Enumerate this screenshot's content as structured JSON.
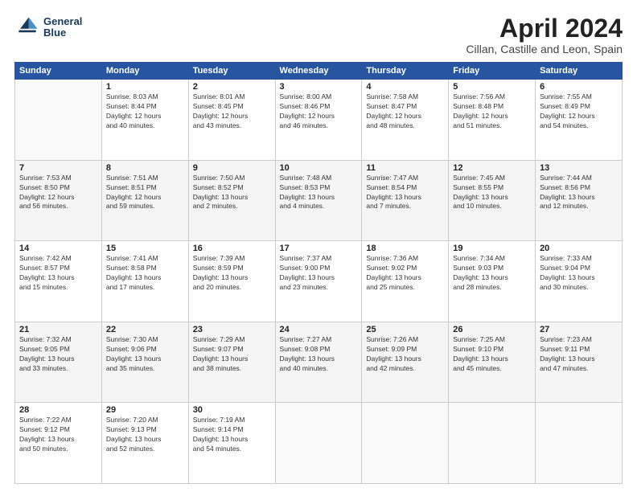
{
  "header": {
    "logo_line1": "General",
    "logo_line2": "Blue",
    "title": "April 2024",
    "subtitle": "Cillan, Castille and Leon, Spain"
  },
  "days_of_week": [
    "Sunday",
    "Monday",
    "Tuesday",
    "Wednesday",
    "Thursday",
    "Friday",
    "Saturday"
  ],
  "weeks": [
    [
      {
        "day": "",
        "info": ""
      },
      {
        "day": "1",
        "info": "Sunrise: 8:03 AM\nSunset: 8:44 PM\nDaylight: 12 hours\nand 40 minutes."
      },
      {
        "day": "2",
        "info": "Sunrise: 8:01 AM\nSunset: 8:45 PM\nDaylight: 12 hours\nand 43 minutes."
      },
      {
        "day": "3",
        "info": "Sunrise: 8:00 AM\nSunset: 8:46 PM\nDaylight: 12 hours\nand 46 minutes."
      },
      {
        "day": "4",
        "info": "Sunrise: 7:58 AM\nSunset: 8:47 PM\nDaylight: 12 hours\nand 48 minutes."
      },
      {
        "day": "5",
        "info": "Sunrise: 7:56 AM\nSunset: 8:48 PM\nDaylight: 12 hours\nand 51 minutes."
      },
      {
        "day": "6",
        "info": "Sunrise: 7:55 AM\nSunset: 8:49 PM\nDaylight: 12 hours\nand 54 minutes."
      }
    ],
    [
      {
        "day": "7",
        "info": "Sunrise: 7:53 AM\nSunset: 8:50 PM\nDaylight: 12 hours\nand 56 minutes."
      },
      {
        "day": "8",
        "info": "Sunrise: 7:51 AM\nSunset: 8:51 PM\nDaylight: 12 hours\nand 59 minutes."
      },
      {
        "day": "9",
        "info": "Sunrise: 7:50 AM\nSunset: 8:52 PM\nDaylight: 13 hours\nand 2 minutes."
      },
      {
        "day": "10",
        "info": "Sunrise: 7:48 AM\nSunset: 8:53 PM\nDaylight: 13 hours\nand 4 minutes."
      },
      {
        "day": "11",
        "info": "Sunrise: 7:47 AM\nSunset: 8:54 PM\nDaylight: 13 hours\nand 7 minutes."
      },
      {
        "day": "12",
        "info": "Sunrise: 7:45 AM\nSunset: 8:55 PM\nDaylight: 13 hours\nand 10 minutes."
      },
      {
        "day": "13",
        "info": "Sunrise: 7:44 AM\nSunset: 8:56 PM\nDaylight: 13 hours\nand 12 minutes."
      }
    ],
    [
      {
        "day": "14",
        "info": "Sunrise: 7:42 AM\nSunset: 8:57 PM\nDaylight: 13 hours\nand 15 minutes."
      },
      {
        "day": "15",
        "info": "Sunrise: 7:41 AM\nSunset: 8:58 PM\nDaylight: 13 hours\nand 17 minutes."
      },
      {
        "day": "16",
        "info": "Sunrise: 7:39 AM\nSunset: 8:59 PM\nDaylight: 13 hours\nand 20 minutes."
      },
      {
        "day": "17",
        "info": "Sunrise: 7:37 AM\nSunset: 9:00 PM\nDaylight: 13 hours\nand 23 minutes."
      },
      {
        "day": "18",
        "info": "Sunrise: 7:36 AM\nSunset: 9:02 PM\nDaylight: 13 hours\nand 25 minutes."
      },
      {
        "day": "19",
        "info": "Sunrise: 7:34 AM\nSunset: 9:03 PM\nDaylight: 13 hours\nand 28 minutes."
      },
      {
        "day": "20",
        "info": "Sunrise: 7:33 AM\nSunset: 9:04 PM\nDaylight: 13 hours\nand 30 minutes."
      }
    ],
    [
      {
        "day": "21",
        "info": "Sunrise: 7:32 AM\nSunset: 9:05 PM\nDaylight: 13 hours\nand 33 minutes."
      },
      {
        "day": "22",
        "info": "Sunrise: 7:30 AM\nSunset: 9:06 PM\nDaylight: 13 hours\nand 35 minutes."
      },
      {
        "day": "23",
        "info": "Sunrise: 7:29 AM\nSunset: 9:07 PM\nDaylight: 13 hours\nand 38 minutes."
      },
      {
        "day": "24",
        "info": "Sunrise: 7:27 AM\nSunset: 9:08 PM\nDaylight: 13 hours\nand 40 minutes."
      },
      {
        "day": "25",
        "info": "Sunrise: 7:26 AM\nSunset: 9:09 PM\nDaylight: 13 hours\nand 42 minutes."
      },
      {
        "day": "26",
        "info": "Sunrise: 7:25 AM\nSunset: 9:10 PM\nDaylight: 13 hours\nand 45 minutes."
      },
      {
        "day": "27",
        "info": "Sunrise: 7:23 AM\nSunset: 9:11 PM\nDaylight: 13 hours\nand 47 minutes."
      }
    ],
    [
      {
        "day": "28",
        "info": "Sunrise: 7:22 AM\nSunset: 9:12 PM\nDaylight: 13 hours\nand 50 minutes."
      },
      {
        "day": "29",
        "info": "Sunrise: 7:20 AM\nSunset: 9:13 PM\nDaylight: 13 hours\nand 52 minutes."
      },
      {
        "day": "30",
        "info": "Sunrise: 7:19 AM\nSunset: 9:14 PM\nDaylight: 13 hours\nand 54 minutes."
      },
      {
        "day": "",
        "info": ""
      },
      {
        "day": "",
        "info": ""
      },
      {
        "day": "",
        "info": ""
      },
      {
        "day": "",
        "info": ""
      }
    ]
  ]
}
